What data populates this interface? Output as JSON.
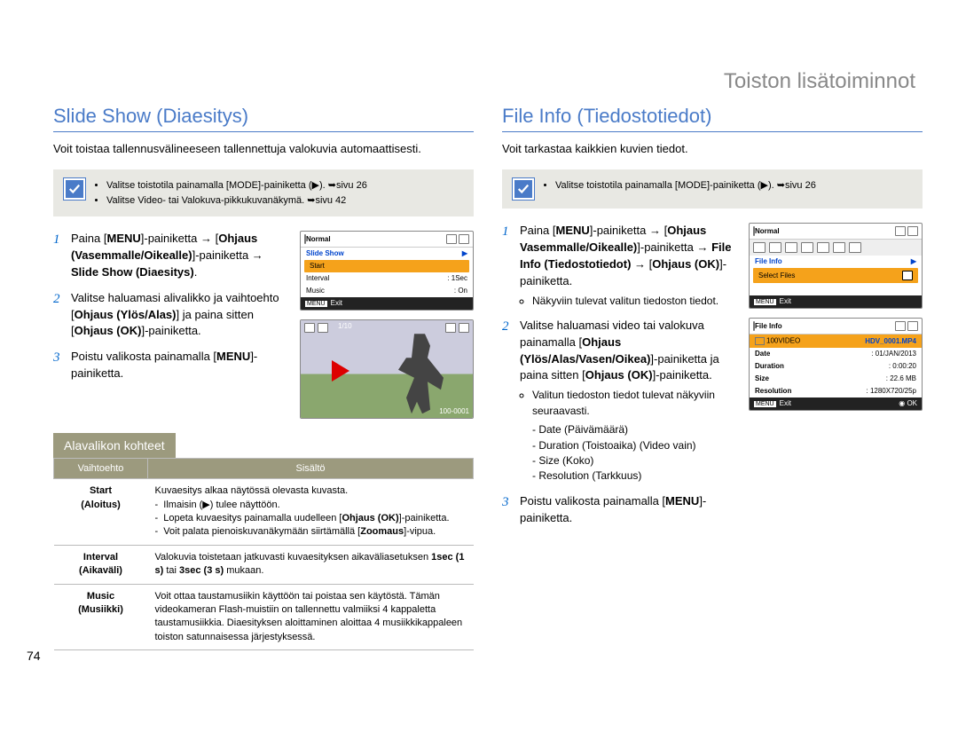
{
  "chapter_title": "Toiston lisätoiminnot",
  "page_number": "74",
  "left": {
    "title": "Slide Show (Diaesitys)",
    "intro": "Voit toistaa tallennusvälineeseen tallennettuja valokuvia automaattisesti.",
    "note_items": [
      "Valitse toistotila painamalla [MODE]-painiketta (▶). ➥sivu 26",
      "Valitse Video- tai Valokuva-pikkukuvanäkymä. ➥sivu 42"
    ],
    "steps": [
      "Paina [MENU]-painiketta → [Ohjaus (Vasemmalle/Oikealle)]-painiketta → Slide Show (Diaesitys).",
      "Valitse haluamasi alivalikko ja vaihtoehto [Ohjaus (Ylös/Alas)] ja paina sitten [Ohjaus (OK)]-painiketta.",
      "Poistu valikosta painamalla [MENU]-painiketta."
    ],
    "screens": {
      "menu": {
        "title": "Normal",
        "item1": "Slide Show",
        "item2": "Start",
        "item3": "Interval",
        "item3_val": ": 1Sec",
        "item4": "Music",
        "item4_val": ": On",
        "exit": "Exit"
      },
      "preview": {
        "counter": "1/10",
        "folder": "100-0001"
      }
    },
    "sub_heading": "Alavalikon kohteet",
    "table": {
      "headers": [
        "Vaihtoehto",
        "Sisältö"
      ],
      "rows": [
        {
          "opt": "Start\n(Aloitus)",
          "desc": "Kuvaesitys alkaa näytössä olevasta kuvasta.\n-  Ilmaisin (▶) tulee näyttöön.\n-  Lopeta kuvaesitys painamalla uudelleen [Ohjaus (OK)]-painiketta.\n-  Voit palata pienoiskuvanäkymään siirtämällä [Zoomaus]-vipua."
        },
        {
          "opt": "Interval\n(Aikaväli)",
          "desc": "Valokuvia toistetaan jatkuvasti kuvaesityksen aikaväliasetuksen 1sec (1 s) tai 3sec (3 s) mukaan."
        },
        {
          "opt": "Music\n(Musiikki)",
          "desc": "Voit ottaa taustamusiikin käyttöön tai poistaa sen käytöstä. Tämän videokameran Flash-muistiin on tallennettu valmiiksi 4 kappaletta taustamusiikkia. Diaesityksen aloittaminen aloittaa 4 musiikkikappaleen toiston satunnaisessa järjestyksessä."
        }
      ]
    }
  },
  "right": {
    "title": "File Info (Tiedostotiedot)",
    "intro": "Voit tarkastaa kaikkien kuvien tiedot.",
    "note_items": [
      "Valitse toistotila painamalla [MODE]-painiketta (▶). ➥sivu 26"
    ],
    "steps": [
      {
        "text": "Paina [MENU]-painiketta → [Ohjaus Vasemmalle/Oikealle)]-painiketta → File Info (Tiedostotiedot) → [Ohjaus (OK)]-painiketta.",
        "bullets": [
          "Näkyviin tulevat valitun tiedoston tiedot."
        ]
      },
      {
        "text": "Valitse haluamasi video tai valokuva painamalla [Ohjaus (Ylös/Alas/Vasen/Oikea)]-painiketta ja paina sitten [Ohjaus (OK)]-painiketta.",
        "bullets": [
          "Valitun tiedoston tiedot tulevat näkyviin seuraavasti."
        ],
        "dashes": [
          "Date (Päivämäärä)",
          "Duration (Toistoaika) (Video vain)",
          "Size (Koko)",
          "Resolution (Tarkkuus)"
        ]
      },
      {
        "text": "Poistu valikosta painamalla [MENU]-painiketta."
      }
    ],
    "screens": {
      "menu": {
        "title": "Normal",
        "item1": "File Info",
        "item2": "Select Files",
        "exit": "Exit"
      },
      "info": {
        "title": "File Info",
        "folder": "100VIDEO",
        "file": "HDV_0001.MP4",
        "rows": [
          [
            "Date",
            ": 01/JAN/2013"
          ],
          [
            "Duration",
            ": 0:00:20"
          ],
          [
            "Size",
            ": 22.6 MB"
          ],
          [
            "Resolution",
            ": 1280X720/25p"
          ]
        ],
        "exit": "Exit",
        "ok": "OK"
      }
    }
  }
}
